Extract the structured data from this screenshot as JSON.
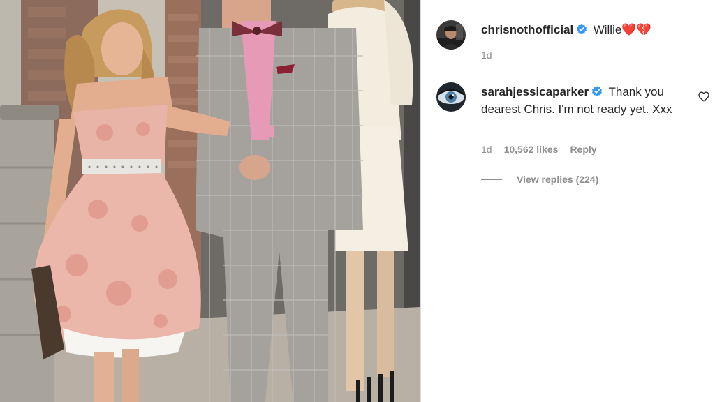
{
  "post": {
    "caption": {
      "username": "chrisnothofficial",
      "verified": true,
      "text": "Willie❤️💔",
      "timestamp": "1d",
      "avatar_icon": "profile-photo-chris"
    },
    "comments": [
      {
        "username": "sarahjessicaparker",
        "verified": true,
        "text": "Thank you dearest Chris. I'm not ready yet. Xxx",
        "timestamp": "1d",
        "likes": "10,562 likes",
        "reply_label": "Reply",
        "like_icon": "heart-outline-icon",
        "avatar_icon": "profile-photo-sarah"
      }
    ],
    "view_replies_label": "View replies (224)"
  },
  "colors": {
    "text": "#262626",
    "secondary": "#8e8e8e",
    "verified": "#3897f0",
    "divider": "#dbdbdb"
  }
}
